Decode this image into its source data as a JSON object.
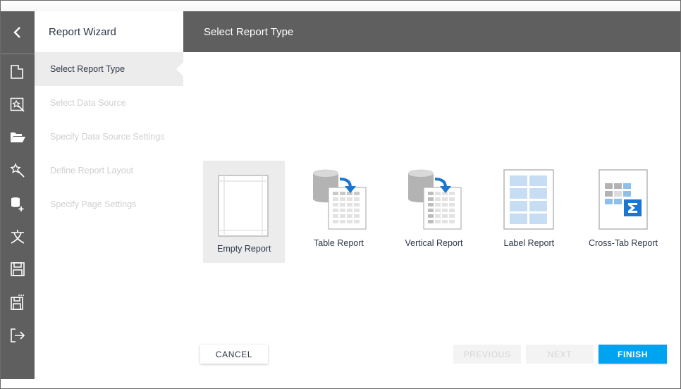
{
  "rail": {
    "items": [
      {
        "icon": "chevron-left-icon"
      },
      {
        "icon": "new-report-icon"
      },
      {
        "icon": "design-in-wizard-icon"
      },
      {
        "icon": "open-folder-icon"
      },
      {
        "icon": "wizard-icon"
      },
      {
        "icon": "add-data-source-icon"
      },
      {
        "icon": "localization-icon"
      },
      {
        "icon": "save-icon"
      },
      {
        "icon": "save-as-icon"
      },
      {
        "icon": "exit-icon"
      }
    ]
  },
  "wizard": {
    "title": "Report Wizard",
    "steps": [
      {
        "label": "Select Report Type",
        "active": true
      },
      {
        "label": "Select Data Source",
        "active": false
      },
      {
        "label": "Specify Data Source Settings",
        "active": false
      },
      {
        "label": "Define Report Layout",
        "active": false
      },
      {
        "label": "Specify Page Settings",
        "active": false
      }
    ]
  },
  "header": {
    "title": "Select Report Type"
  },
  "report_types": [
    {
      "label": "Empty Report",
      "selected": true
    },
    {
      "label": "Table Report",
      "selected": false
    },
    {
      "label": "Vertical Report",
      "selected": false
    },
    {
      "label": "Label Report",
      "selected": false
    },
    {
      "label": "Cross-Tab Report",
      "selected": false
    }
  ],
  "buttons": {
    "cancel": "CANCEL",
    "previous": "PREVIOUS",
    "next": "NEXT",
    "finish": "FINISH"
  },
  "colors": {
    "accent": "#00a3f0",
    "rail_bg": "#5f5f5f",
    "active_step_bg": "#ececec"
  }
}
